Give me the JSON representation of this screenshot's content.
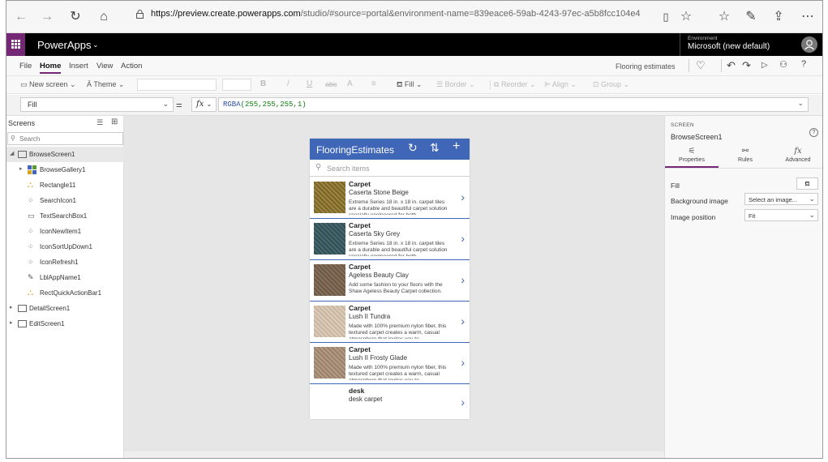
{
  "browser": {
    "url_host": "https://preview.create.powerapps.com",
    "url_path": "/studio/#source=portal&environment-name=839eace6-59ab-4243-97ec-a5b8fcc104e4"
  },
  "app": {
    "name": "PowerApps",
    "environment_caption": "Environment",
    "environment_name": "Microsoft (new default)"
  },
  "menu": {
    "items": [
      "File",
      "Home",
      "Insert",
      "View",
      "Action"
    ],
    "active": "Home",
    "project_name": "Flooring estimates"
  },
  "ribbon": {
    "new_screen": "New screen",
    "theme": "Theme",
    "bold": "B",
    "italic": "/",
    "underline": "U",
    "strike": "abc",
    "font_color": "A",
    "align_text": "≡",
    "fill": "Fill",
    "border": "Border",
    "reorder": "Reorder",
    "align": "Align",
    "group": "Group"
  },
  "formula_bar": {
    "property": "Fill",
    "equals": "=",
    "fx": "fx",
    "fn": "RGBA",
    "args": "(255,255,255,1)"
  },
  "tree": {
    "header": "Screens",
    "search_placeholder": "Search",
    "items": [
      {
        "label": "BrowseScreen1"
      },
      {
        "label": "BrowseGallery1"
      },
      {
        "label": "Rectangle11"
      },
      {
        "label": "SearchIcon1"
      },
      {
        "label": "TextSearchBox1"
      },
      {
        "label": "IconNewItem1"
      },
      {
        "label": "IconSortUpDown1"
      },
      {
        "label": "IconRefresh1"
      },
      {
        "label": "LblAppName1"
      },
      {
        "label": "RectQuickActionBar1"
      },
      {
        "label": "DetailScreen1"
      },
      {
        "label": "EditScreen1"
      }
    ]
  },
  "phone": {
    "title": "FlooringEstimates",
    "search_placeholder": "Search items",
    "items": [
      {
        "title": "Carpet",
        "subtitle": "Caserta Stone Beige",
        "desc": "Extreme Series 18 in. x 18 in. carpet tiles are a durable and beautiful carpet solution specially engineered for both",
        "color": "#8a7434"
      },
      {
        "title": "Carpet",
        "subtitle": "Caserta Sky Grey",
        "desc": "Extreme Series 18 in. x 18 in. carpet tiles are a durable and beautiful carpet solution specially engineered for both",
        "color": "#3e5d63"
      },
      {
        "title": "Carpet",
        "subtitle": "Ageless Beauty Clay",
        "desc": "Add some fashion to your floors with the Shaw Ageless Beauty Carpet collection.",
        "color": "#7a6650"
      },
      {
        "title": "Carpet",
        "subtitle": "Lush II Tundra",
        "desc": "Made with 100% premium nylon fiber, this textured carpet creates a warm, casual atmosphere that invites you to",
        "color": "#d2c1ad"
      },
      {
        "title": "Carpet",
        "subtitle": "Lush II Frosty Glade",
        "desc": "Made with 100% premium nylon fiber, this textured carpet creates a warm, casual atmosphere that invites you to",
        "color": "#a88f7a"
      },
      {
        "title": "desk",
        "subtitle": "desk carpet",
        "desc": "",
        "color": ""
      }
    ]
  },
  "props": {
    "caption": "SCREEN",
    "name": "BrowseScreen1",
    "tabs": [
      "Properties",
      "Rules",
      "Advanced"
    ],
    "fill_label": "Fill",
    "bg_image_label": "Background image",
    "bg_image_value": "Select an image...",
    "img_pos_label": "Image position",
    "img_pos_value": "Fit"
  },
  "colors": {
    "accent": "#742774",
    "header_blue": "#3f66b7"
  }
}
